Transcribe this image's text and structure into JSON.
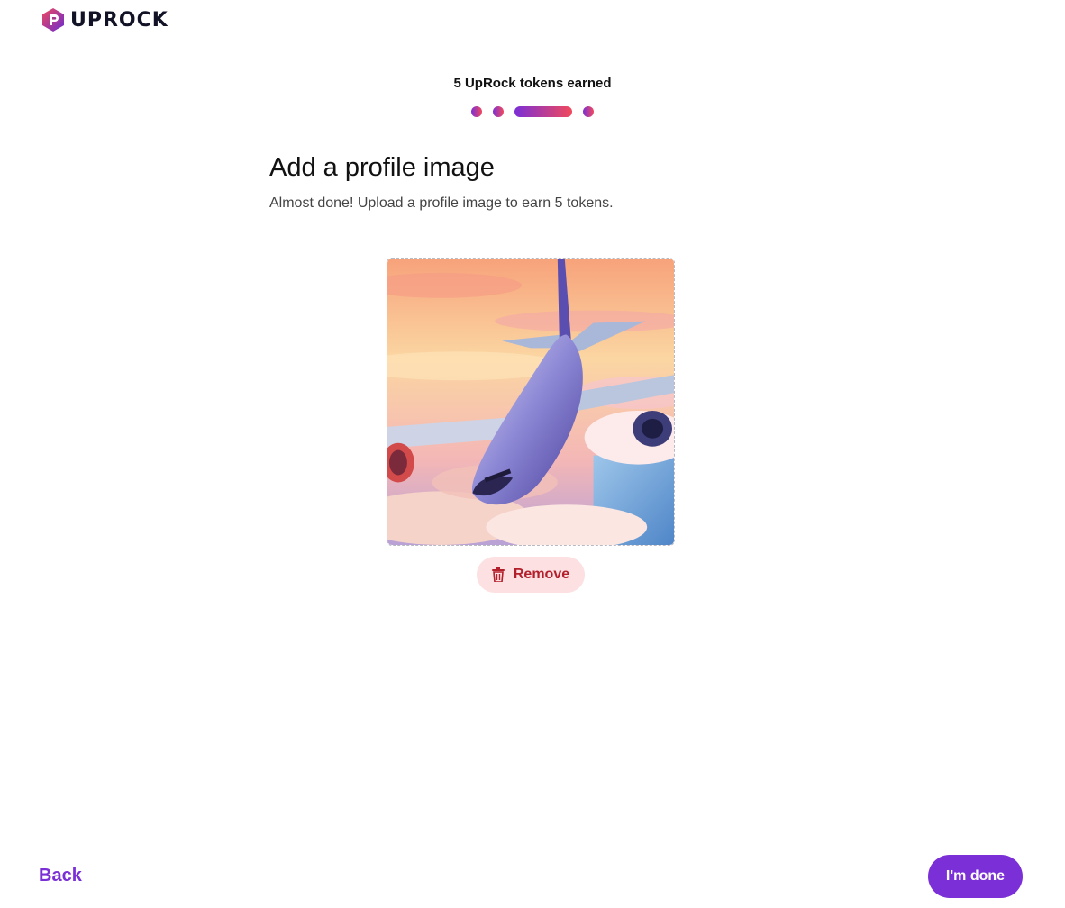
{
  "app": {
    "logo_text": "UPROCK",
    "logo_icon": "uprock-logo-icon"
  },
  "progress": {
    "label": "5 UpRock tokens earned",
    "total_steps": 4,
    "current_step": 3,
    "gradient_start": "#7b2fd6",
    "gradient_end": "#f04a5c"
  },
  "main": {
    "title": "Add a profile image",
    "subtitle": "Almost done! Upload a profile image to earn 5 tokens."
  },
  "profile_image": {
    "subject": "airplane-illustration"
  },
  "actions": {
    "remove_label": "Remove",
    "remove_icon": "trash-icon",
    "back_label": "Back",
    "done_label": "I'm done"
  },
  "colors": {
    "accent": "#7b2fd6",
    "danger_bg": "#fde0e1",
    "danger_text": "#b3202c"
  }
}
